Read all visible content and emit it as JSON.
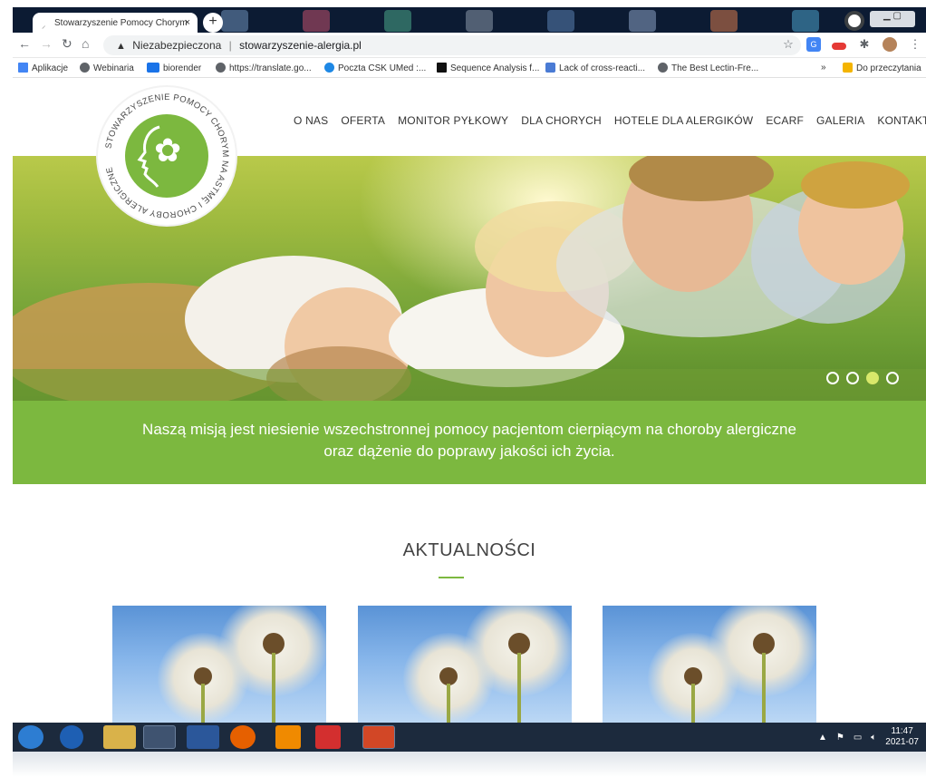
{
  "browser": {
    "tab_title": "Stowarzyszenie Pomocy Chorym",
    "tab_close": "×",
    "new_tab": "+",
    "security_label": "Niezabezpieczona",
    "url": "stowarzyszenie-alergia.pl"
  },
  "bookmarks": {
    "items": [
      {
        "label": "Aplikacje",
        "icon": "apps-grid-icon"
      },
      {
        "label": "Webinaria",
        "icon": "globe-icon"
      },
      {
        "label": "biorender",
        "icon": "biorender-icon"
      },
      {
        "label": "https://translate.go...",
        "icon": "globe-icon"
      },
      {
        "label": "Poczta CSK UMed :...",
        "icon": "mail-icon"
      },
      {
        "label": "Sequence Analysis f...",
        "icon": "w-icon"
      },
      {
        "label": "Lack of cross-reacti...",
        "icon": "translate-icon"
      },
      {
        "label": "The Best Lectin-Fre...",
        "icon": "globe-icon"
      }
    ],
    "overflow": "»",
    "reading_list": "Do przeczytania"
  },
  "site": {
    "logo_text": "STOWARZYSZENIE POMOCY CHORYM NA ASTMĘ I CHOROBY ALERGICZNE",
    "nav": [
      "O NAS",
      "OFERTA",
      "MONITOR PYŁKOWY",
      "DLA CHORYCH",
      "HOTELE DLA ALERGIKÓW",
      "ECARF",
      "GALERIA",
      "KONTAKT"
    ],
    "mission_line1": "Naszą misją jest niesienie wszechstronnej pomocy pacjentom cierpiącym na choroby alergiczne",
    "mission_line2": "oraz dążenie do poprawy jakości ich życia.",
    "news_title": "AKTUALNOŚCI",
    "slider_dots": 4,
    "slider_active": 3
  },
  "taskbar": {
    "time": "11:47",
    "date": "2021-07"
  },
  "colors": {
    "brand_green": "#7cb83f",
    "tabstrip": "#0c1b33",
    "taskbar": "#1c2a3d"
  }
}
